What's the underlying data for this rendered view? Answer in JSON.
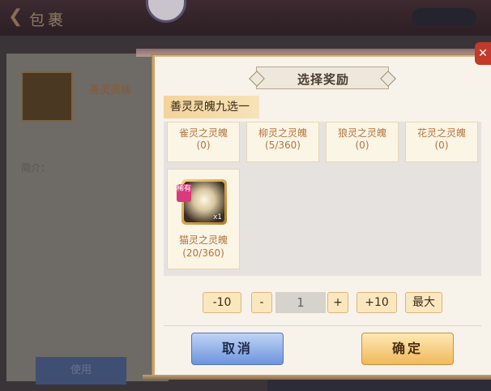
{
  "background": {
    "title": "包裹",
    "item_name": "善灵灵魄",
    "desc_title": "简介：",
    "use_button": "使用"
  },
  "dialog": {
    "title": "选择奖励",
    "subtitle": "善灵灵魄九选一",
    "options": [
      {
        "name": "雀灵之灵魄",
        "count": "(0)"
      },
      {
        "name": "柳灵之灵魄",
        "count": "(5/360)"
      },
      {
        "name": "狼灵之灵魄",
        "count": "(0)"
      },
      {
        "name": "花灵之灵魄",
        "count": "(0)"
      },
      {
        "name": "猫灵之灵魄",
        "count": "(20/360)",
        "badge": "稀有",
        "qty": "x1"
      }
    ],
    "quantity": {
      "minus10": "-10",
      "minus": "-",
      "value": "1",
      "plus": "+",
      "plus10": "+10",
      "max": "最大"
    },
    "cancel": "取消",
    "confirm": "确定"
  }
}
